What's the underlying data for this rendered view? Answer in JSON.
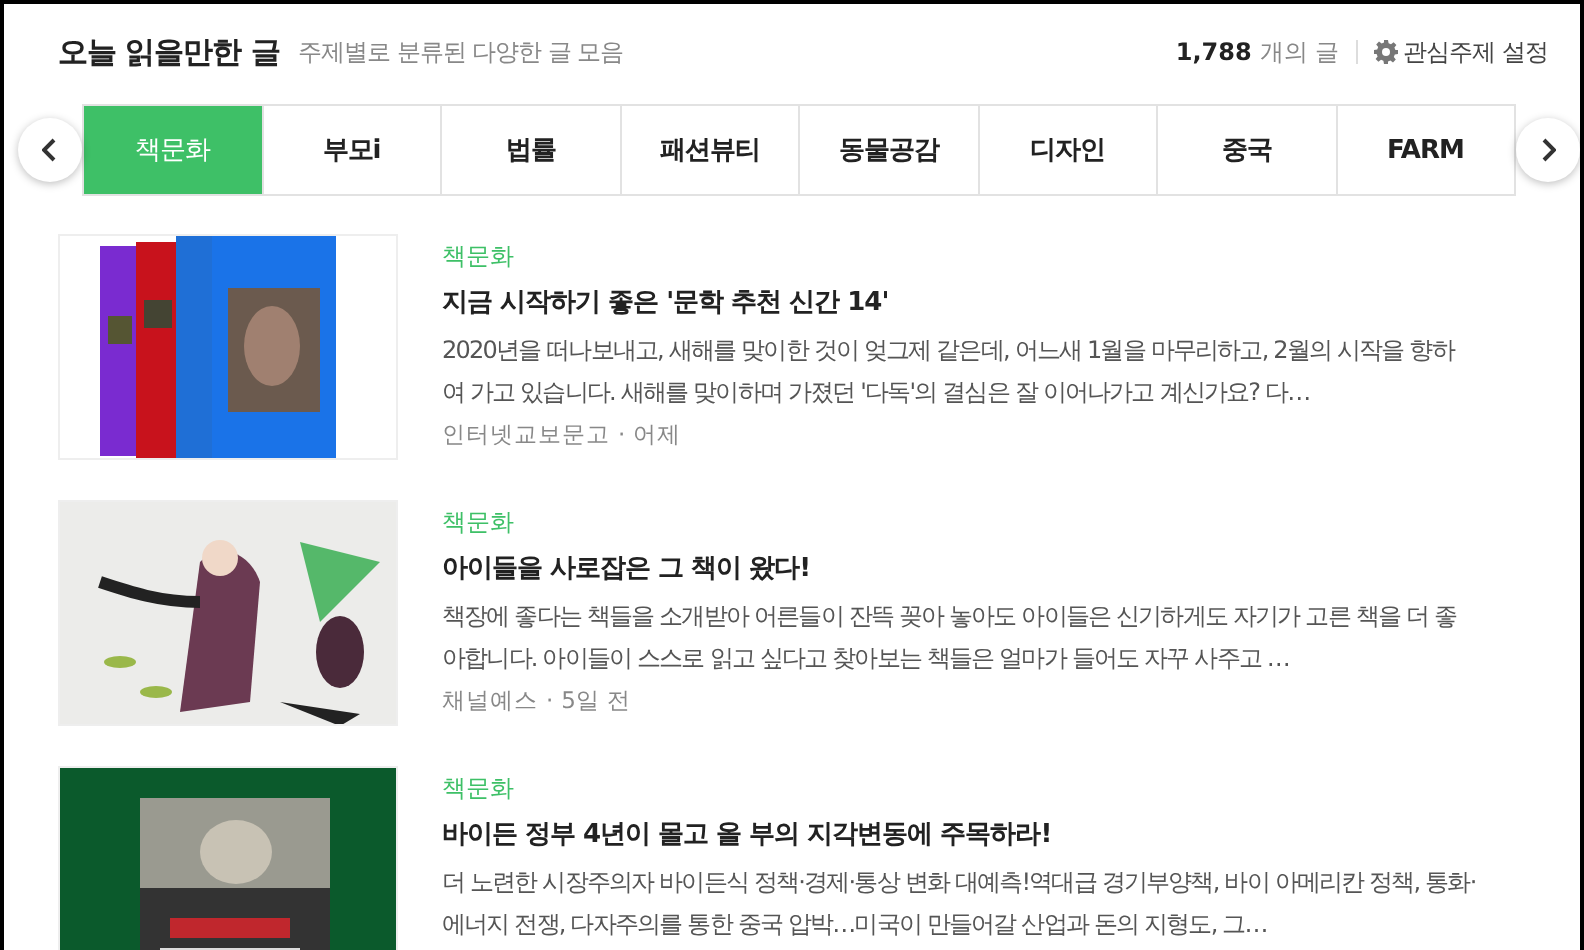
{
  "header": {
    "title": "오늘 읽을만한 글",
    "subtitle": "주제별로 분류된 다양한 글 모음",
    "count": "1,788",
    "count_unit": "개의 글",
    "settings_label": "관심주제 설정"
  },
  "tabs": [
    {
      "label": "책문화",
      "selected": true
    },
    {
      "label": "부모i",
      "selected": false
    },
    {
      "label": "법률",
      "selected": false
    },
    {
      "label": "패션뷰티",
      "selected": false
    },
    {
      "label": "동물공감",
      "selected": false
    },
    {
      "label": "디자인",
      "selected": false
    },
    {
      "label": "중국",
      "selected": false
    },
    {
      "label": "FARM",
      "selected": false
    }
  ],
  "articles": [
    {
      "category": "책문화",
      "title": "지금 시작하기 좋은 '문학 추천 신간 14'",
      "summary": "2020년을 떠나보내고, 새해를 맞이한 것이 엊그제 같은데, 어느새 1월을 마무리하고, 2월의 시작을 향하여 가고 있습니다. 새해를 맞이하며 가졌던 '다독'의 결심은 잘 이어나가고 계신가요? 다…",
      "source": "인터넷교보문고",
      "separator": "·",
      "time": "어제"
    },
    {
      "category": "책문화",
      "title": "아이들을 사로잡은 그 책이 왔다!",
      "summary": "책장에 좋다는 책들을 소개받아 어른들이 잔뜩 꽂아 놓아도 아이들은 신기하게도 자기가 고른 책을 더 좋아합니다. 아이들이 스스로 읽고 싶다고 찾아보는 책들은 얼마가 들어도 자꾸 사주고 …",
      "source": "채널예스",
      "separator": "·",
      "time": "5일 전"
    },
    {
      "category": "책문화",
      "title": "바이든 정부 4년이 몰고 올 부의 지각변동에 주목하라!",
      "summary": "더 노련한 시장주의자 바이든식 정책·경제·통상 변화 대예측!역대급 경기부양책, 바이 아메리칸 정책, 통화·에너지 전쟁, 다자주의를 통한 중국 압박…미국이 만들어갈 산업과 돈의 지형도, 그…"
    }
  ]
}
